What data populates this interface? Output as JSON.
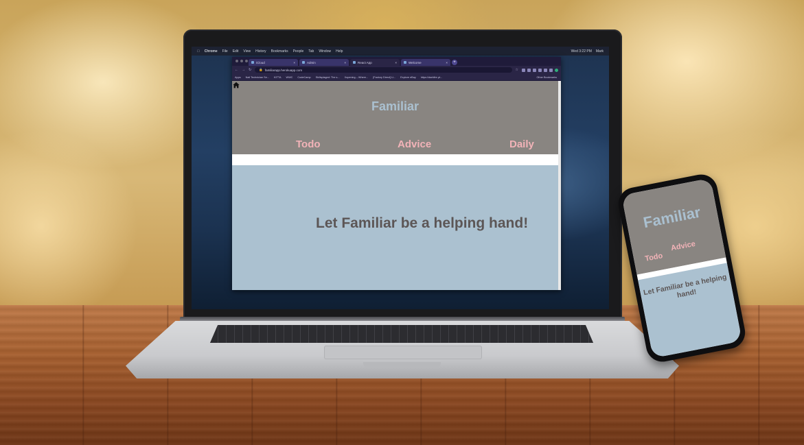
{
  "app": {
    "brand": "Familiar",
    "nav": [
      "Todo",
      "Advice",
      "Daily"
    ],
    "hero_text": "Let Familiar be a helping hand!",
    "colors": {
      "header_bg": "#898581",
      "brand_text": "#aac0d0",
      "nav_text": "#f2b3b8",
      "hero_bg": "#abc1d0",
      "hero_text": "#5c5656"
    }
  },
  "browser": {
    "tabs": [
      {
        "label": "iCloud",
        "active": false
      },
      {
        "label": "Admin",
        "active": false
      },
      {
        "label": "React App",
        "active": true
      },
      {
        "label": "Welcome",
        "active": false
      }
    ],
    "url": "familiarapp.herokuapp.com",
    "bookmarks": [
      "Apps",
      "Nail Technician Se...",
      "KITTA",
      "WWC",
      "CodeCamp",
      "Skillsplaged: The s...",
      "Xopening – Where...",
      "[Factory Direct] Li...",
      "Explore eBay",
      "https://darkfire.pt..."
    ],
    "other_bookmarks": "Other Bookmarks"
  },
  "os_menubar": {
    "app_name": "Chrome",
    "items": [
      "File",
      "Edit",
      "View",
      "History",
      "Bookmarks",
      "People",
      "Tab",
      "Window",
      "Help"
    ],
    "clock": "Wed 3:22 PM",
    "user": "Mark"
  },
  "icons": {
    "home": "home-icon",
    "close": "close-icon",
    "new_tab": "plus-icon",
    "apple": "apple-icon"
  }
}
